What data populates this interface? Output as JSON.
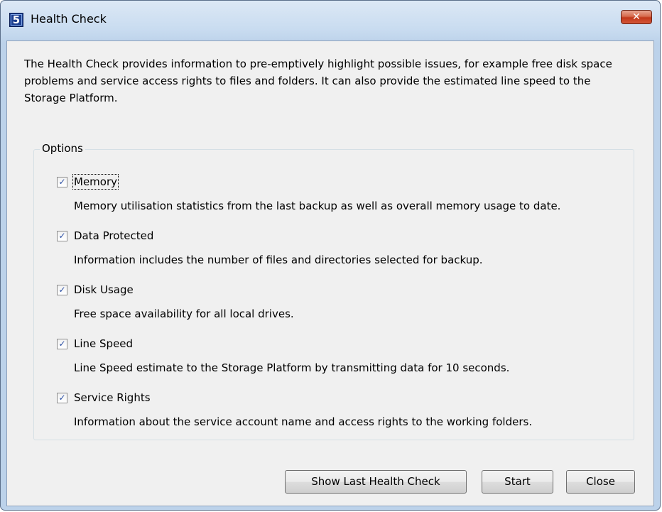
{
  "window": {
    "title": "Health Check",
    "app_icon_glyph": "5",
    "close_glyph": "✕"
  },
  "description": "The Health Check provides information to pre-emptively highlight possible issues, for example free disk space problems and service access rights to files and folders. It can also provide the estimated line speed to the Storage Platform.",
  "options_group": {
    "label": "Options",
    "items": [
      {
        "label": "Memory",
        "checked": true,
        "description": "Memory utilisation statistics from the last backup as well as overall memory usage to date."
      },
      {
        "label": "Data Protected",
        "checked": true,
        "description": "Information includes the number of files and directories selected for backup."
      },
      {
        "label": "Disk Usage",
        "checked": true,
        "description": "Free space availability for all local drives."
      },
      {
        "label": "Line Speed",
        "checked": true,
        "description": "Line Speed estimate to the Storage Platform by transmitting data for 10 seconds."
      },
      {
        "label": "Service Rights",
        "checked": true,
        "description": "Information about the service account name and access rights to the working folders."
      }
    ]
  },
  "buttons": {
    "show_last": "Show Last Health Check",
    "start": "Start",
    "close": "Close"
  },
  "check_glyph": "✓",
  "colors": {
    "accent": "#2a4ea4",
    "close_button": "#c2381a"
  }
}
